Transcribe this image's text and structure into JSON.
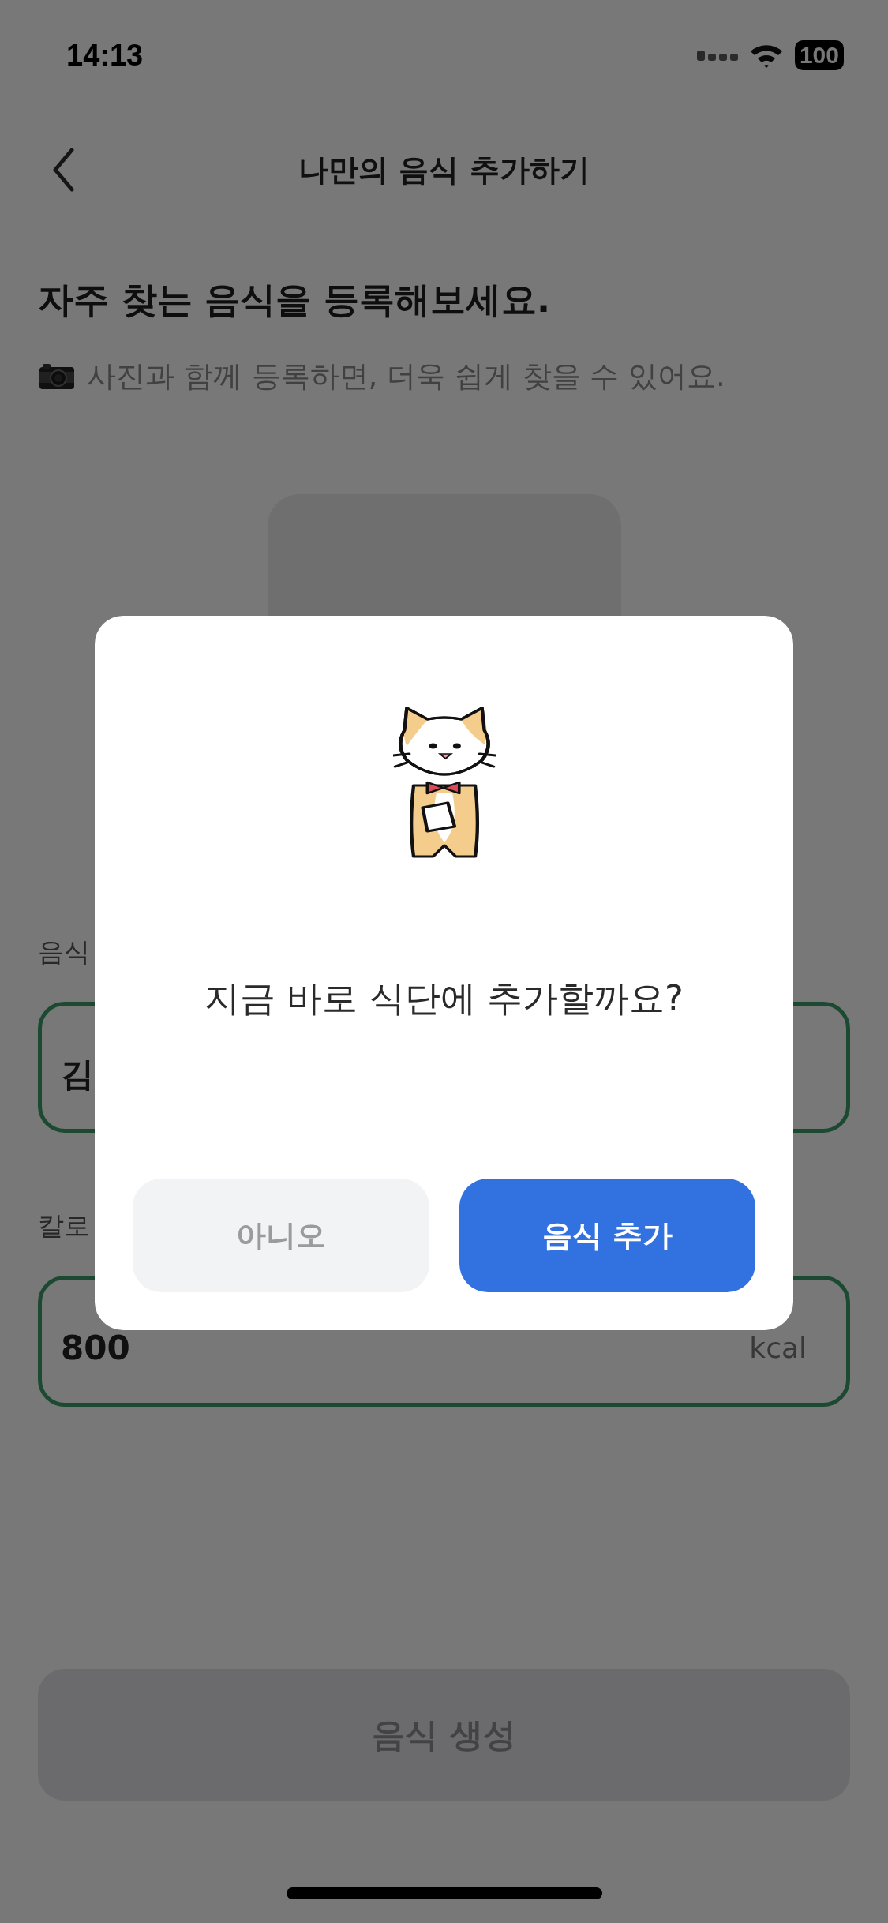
{
  "status_bar": {
    "time": "14:13",
    "battery": "100"
  },
  "header": {
    "title": "나만의 음식 추가하기"
  },
  "intro": {
    "heading": "자주 찾는 음식을 등록해보세요.",
    "hint": "사진과 함께 등록하면, 더욱 쉽게 찾을 수 있어요."
  },
  "fields": [
    {
      "label": "음식",
      "value": "김"
    },
    {
      "label": "칼로",
      "value": "800",
      "unit": "kcal"
    }
  ],
  "create_button": {
    "label": "음식 생성",
    "disabled": true
  },
  "dialog": {
    "message": "지금 바로 식단에 추가할까요?",
    "buttons": [
      {
        "label": "아니오",
        "kind": "secondary"
      },
      {
        "label": "음식 추가",
        "kind": "primary"
      }
    ]
  }
}
